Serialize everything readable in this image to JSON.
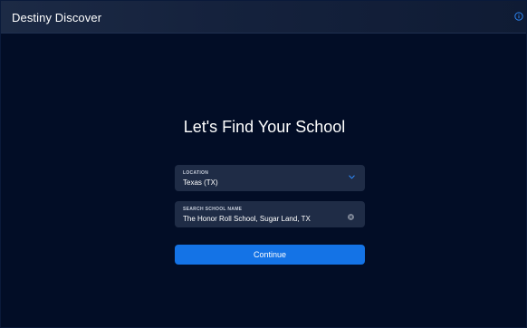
{
  "header": {
    "app_title": "Destiny Discover",
    "info_icon": "info-icon"
  },
  "main": {
    "heading": "Let's Find Your School",
    "location": {
      "label": "LOCATION",
      "value": "Texas (TX)",
      "icon": "chevron-down-icon"
    },
    "school": {
      "label": "SEARCH SCHOOL NAME",
      "value": "The Honor Roll School, Sugar Land, TX",
      "icon": "clear-icon"
    },
    "continue_label": "Continue"
  },
  "colors": {
    "background": "#020d26",
    "field_background": "#1f2c46",
    "accent": "#1473e6",
    "info_icon": "#2f8cff"
  }
}
